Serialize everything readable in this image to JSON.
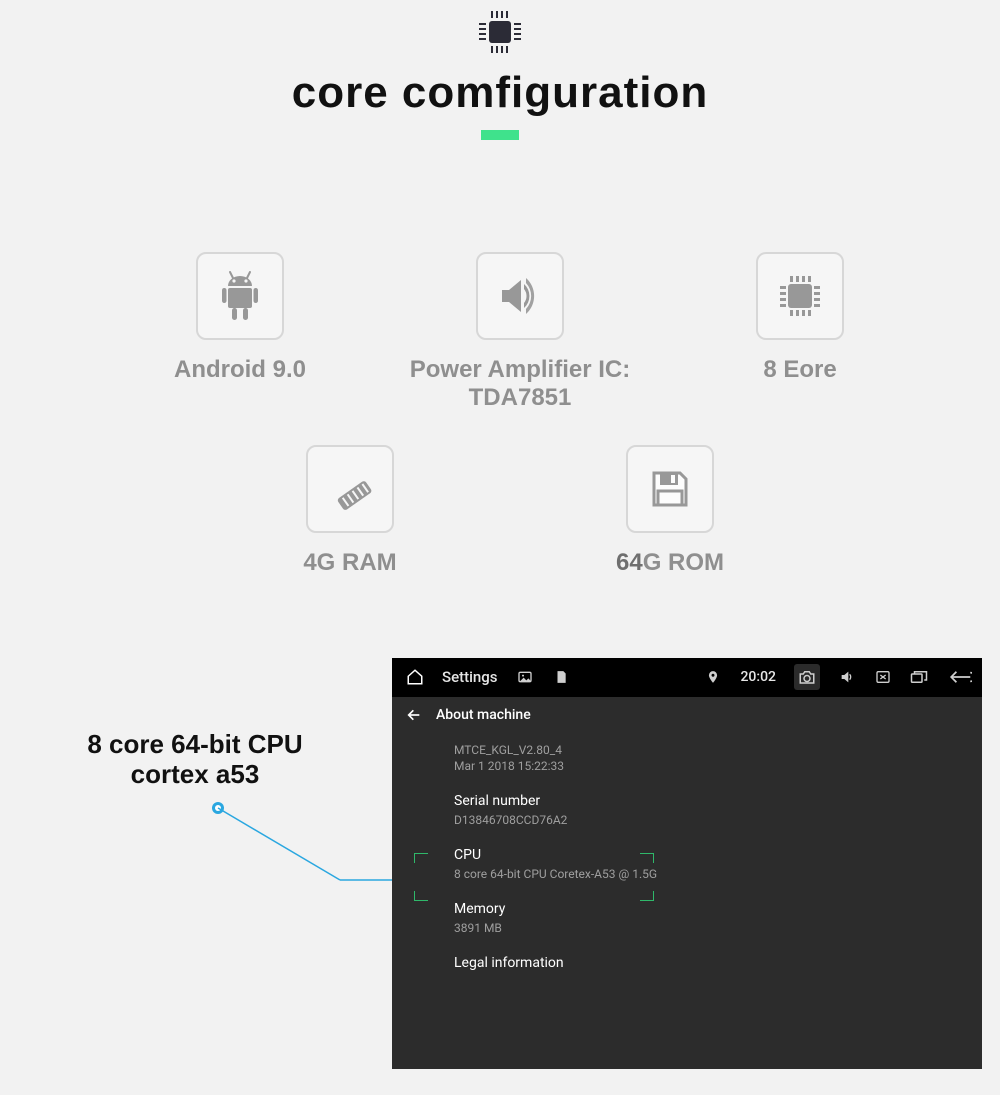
{
  "header": {
    "title": "core comfiguration"
  },
  "features": {
    "f1": {
      "label": "Android 9.0"
    },
    "f2": {
      "label": "Power Amplifier IC:\nTDA7851"
    },
    "f3": {
      "label": "8 Eore"
    },
    "f4": {
      "label": "4G RAM"
    },
    "f5_num": "64",
    "f5_rest": "G ROM"
  },
  "callout": {
    "line1": "8 core 64-bit CPU",
    "line2": "cortex a53"
  },
  "panel": {
    "status": {
      "title": "Settings",
      "time": "20:02"
    },
    "subheader": "About machine",
    "items": {
      "build": {
        "v1": "MTCE_KGL_V2.80_4",
        "v2": "Mar  1 2018 15:22:33"
      },
      "serial": {
        "k": "Serial number",
        "v": "D13846708CCD76A2"
      },
      "cpu": {
        "k": "CPU",
        "v": "8 core 64-bit CPU Coretex-A53 @ 1.5G"
      },
      "memory": {
        "k": "Memory",
        "v": "3891 MB"
      },
      "legal": {
        "k": "Legal information"
      }
    }
  }
}
